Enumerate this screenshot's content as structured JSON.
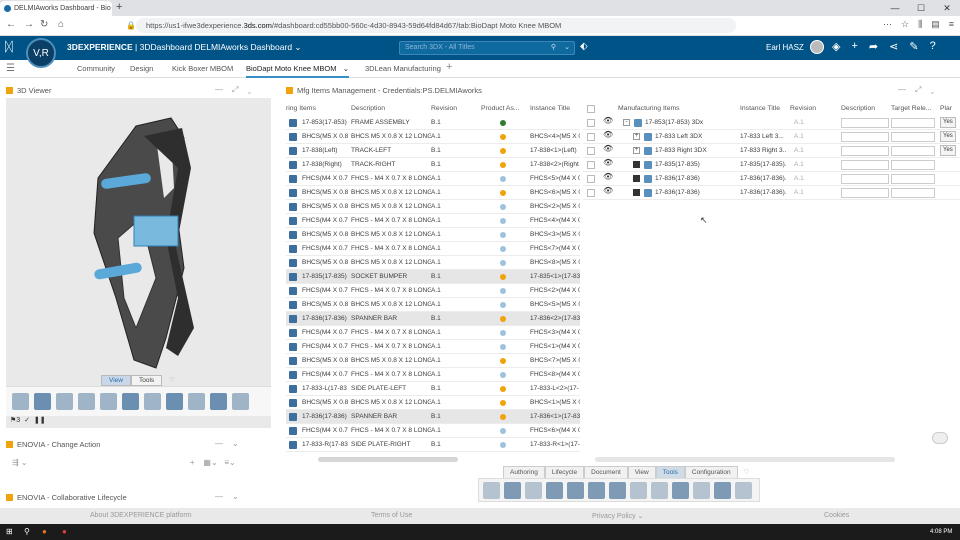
{
  "browser": {
    "tab_title": "DELMIAworks Dashboard - Bio",
    "url_host": "https://us1-ifwe3dexperience.",
    "url_domain": "3ds.com",
    "url_path": "/#dashboard:cd55bb00-560c-4d30-8943-59d64fd84d67/tab:BioDapt Moto Knee MBOM"
  },
  "topbar": {
    "brand_bold": "3DEXPERIENCE",
    "brand_rest": " | 3DDashboard  DELMIAworks Dashboard ⌄",
    "search_placeholder": "Search 3DX - All Titles",
    "user_name": "Earl HASZ",
    "compass_label": "V,R"
  },
  "dashboard_tabs": [
    "Community",
    "Design",
    "Kick Boxer MBOM",
    "BioDapt Moto Knee MBOM",
    "3DLean Manufacturing"
  ],
  "viewer": {
    "title": "3D Viewer",
    "tab_view": "View",
    "tab_tools": "Tools",
    "status": "3"
  },
  "change_action": {
    "title": "ENOVIA - Change Action"
  },
  "collab": {
    "title": "ENOVIA - Collaborative Lifecycle"
  },
  "mfg": {
    "title": "Mfg Items Management - Credentials:PS.DELMIAworks"
  },
  "left_grid": {
    "columns": [
      "ring Items",
      "Description",
      "Revision",
      "Product As...",
      "Instance Title"
    ],
    "rows": [
      [
        "17-853(17-853)",
        "FRAME ASSEMBLY",
        "B.1",
        "#2e7d32",
        ""
      ],
      [
        "BHCS(M5 X 0.8",
        "BHCS M5 X 0.8 X 12 LONG",
        "A.1",
        "#f0a30a",
        "BHCS<4>(M5 X 0"
      ],
      [
        "17-838(Left)",
        "TRACK-LEFT",
        "B.1",
        "#f0a30a",
        "17-838<1>(Left)"
      ],
      [
        "17-838(Right)",
        "TRACK-RIGHT",
        "B.1",
        "#f0a30a",
        "17-838<2>(Right"
      ],
      [
        "FHCS(M4 X 0.7",
        "FHCS - M4 X 0.7 X 8 LONG",
        "A.1",
        "#9bc3dc",
        "FHCS<5>(M4 X 0"
      ],
      [
        "BHCS(M5 X 0.8",
        "BHCS M5 X 0.8 X 12 LONG",
        "A.1",
        "#f0a30a",
        "BHCS<6>(M5 X 0"
      ],
      [
        "BHCS(M5 X 0.8",
        "BHCS M5 X 0.8 X 12 LONG",
        "A.1",
        "#9bc3dc",
        "BHCS<2>(M5 X 0"
      ],
      [
        "FHCS(M4 X 0.7",
        "FHCS - M4 X 0.7 X 8 LONG",
        "A.1",
        "#9bc3dc",
        "FHCS<4>(M4 X 0"
      ],
      [
        "BHCS(M5 X 0.8",
        "BHCS M5 X 0.8 X 12 LONG",
        "A.1",
        "#9bc3dc",
        "BHCS<3>(M5 X 0"
      ],
      [
        "FHCS(M4 X 0.7",
        "FHCS - M4 X 0.7 X 8 LONG",
        "A.1",
        "#9bc3dc",
        "FHCS<7>(M4 X 0"
      ],
      [
        "BHCS(M5 X 0.8",
        "BHCS M5 X 0.8 X 12 LONG",
        "A.1",
        "#9bc3dc",
        "BHCS<8>(M5 X 0"
      ],
      [
        "17-835(17-835)",
        "SOCKET BUMPER",
        "B.1",
        "#f0a30a",
        "17-835<1>(17-83"
      ],
      [
        "FHCS(M4 X 0.7",
        "FHCS - M4 X 0.7 X 8 LONG",
        "A.1",
        "#9bc3dc",
        "FHCS<2>(M4 X 0"
      ],
      [
        "BHCS(M5 X 0.8",
        "BHCS M5 X 0.8 X 12 LONG",
        "A.1",
        "#9bc3dc",
        "BHCS<5>(M5 X 0"
      ],
      [
        "17-836(17-836)",
        "SPANNER BAR",
        "B.1",
        "#f0a30a",
        "17-836<2>(17-83"
      ],
      [
        "FHCS(M4 X 0.7",
        "FHCS - M4 X 0.7 X 8 LONG",
        "A.1",
        "#9bc3dc",
        "FHCS<3>(M4 X 0"
      ],
      [
        "FHCS(M4 X 0.7",
        "FHCS - M4 X 0.7 X 8 LONG",
        "A.1",
        "#9bc3dc",
        "FHCS<1>(M4 X 0"
      ],
      [
        "BHCS(M5 X 0.8",
        "BHCS M5 X 0.8 X 12 LONG",
        "A.1",
        "#f0a30a",
        "BHCS<7>(M5 X 0"
      ],
      [
        "FHCS(M4 X 0.7",
        "FHCS - M4 X 0.7 X 8 LONG",
        "A.1",
        "#9bc3dc",
        "FHCS<8>(M4 X 0"
      ],
      [
        "17-833-L(17-83",
        "SIDE PLATE-LEFT",
        "B.1",
        "#f0a30a",
        "17-833-L<2>(17-"
      ],
      [
        "BHCS(M5 X 0.8",
        "BHCS M5 X 0.8 X 12 LONG",
        "A.1",
        "#f0a30a",
        "BHCS<1>(M5 X 0"
      ],
      [
        "17-836(17-836)",
        "SPANNER BAR",
        "B.1",
        "#f0a30a",
        "17-836<1>(17-83"
      ],
      [
        "FHCS(M4 X 0.7",
        "FHCS - M4 X 0.7 X 8 LONG",
        "A.1",
        "#9bc3dc",
        "FHCS<6>(M4 X 0"
      ],
      [
        "17-833-R(17-83",
        "SIDE PLATE-RIGHT",
        "B.1",
        "#9bc3dc",
        "17-833-R<1>(17-"
      ]
    ]
  },
  "right_grid": {
    "columns": [
      "Manufacturing Items",
      "Instance Title",
      "Revision",
      "Description",
      "Target Rele...",
      "Plar"
    ],
    "rows": [
      {
        "name": "17-853(17-853) 3Dx",
        "inst": "",
        "rev": "A.1",
        "expand": "-",
        "indent": 0,
        "yes": true
      },
      {
        "name": "17-833 Left 3DX",
        "inst": "17-833 Left 3...",
        "rev": "A.1",
        "expand": "+",
        "indent": 1,
        "yes": true
      },
      {
        "name": "17-833 Right 3DX",
        "inst": "17-833 Right 3...",
        "rev": "A.1",
        "expand": "+",
        "indent": 1,
        "yes": true
      },
      {
        "name": "17-835(17-835)",
        "inst": "17-835(17-835)...",
        "rev": "A.1",
        "expand": "",
        "indent": 1,
        "yes": false
      },
      {
        "name": "17-836(17-836)",
        "inst": "17-836(17-836)...",
        "rev": "A.1",
        "expand": "",
        "indent": 1,
        "yes": false
      },
      {
        "name": "17-836(17-836)",
        "inst": "17-836(17-836)...",
        "rev": "A.1",
        "expand": "",
        "indent": 1,
        "yes": false
      }
    ],
    "yes_label": "Yes"
  },
  "bottom_tabs": [
    "Authoring",
    "Lifecycle",
    "Document",
    "View",
    "Tools",
    "Configuration"
  ],
  "footer": {
    "about": "About 3DEXPERIENCE platform",
    "terms": "Terms of Use",
    "privacy": "Privacy Policy ⌄",
    "cookies": "Cookies"
  },
  "taskbar": {
    "time": "4:08 PM"
  }
}
